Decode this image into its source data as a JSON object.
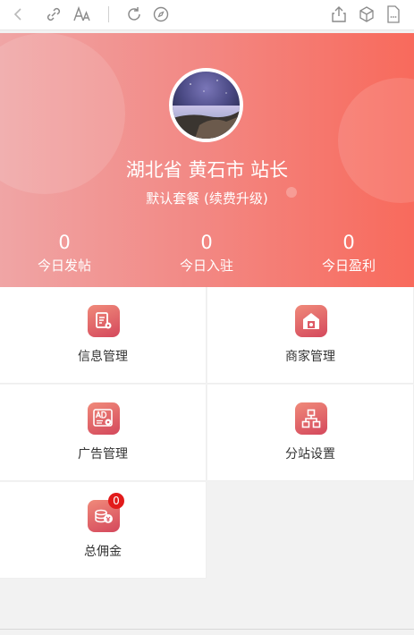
{
  "toolbar": {
    "icons": [
      "back-icon",
      "link-icon",
      "font-size-icon",
      "refresh-icon",
      "compass-icon",
      "share-icon",
      "cube-icon",
      "more-icon"
    ]
  },
  "profile": {
    "title": "湖北省 黄石市 站长",
    "subtitle": "默认套餐 (续费升级)"
  },
  "stats": [
    {
      "value": "0",
      "label": "今日发帖"
    },
    {
      "value": "0",
      "label": "今日入驻"
    },
    {
      "value": "0",
      "label": "今日盈利"
    }
  ],
  "menu": [
    {
      "label": "信息管理",
      "icon": "document-settings-icon"
    },
    {
      "label": "商家管理",
      "icon": "shop-icon"
    },
    {
      "label": "广告管理",
      "icon": "ad-icon"
    },
    {
      "label": "分站设置",
      "icon": "org-chart-icon"
    },
    {
      "label": "总佣金",
      "icon": "coins-icon",
      "badge": "0"
    }
  ],
  "colors": {
    "hero_start": "#f0a5a5",
    "hero_end": "#f86a5c",
    "icon_start": "#f08a7a",
    "icon_end": "#d4485c",
    "badge": "#e21b1b"
  }
}
